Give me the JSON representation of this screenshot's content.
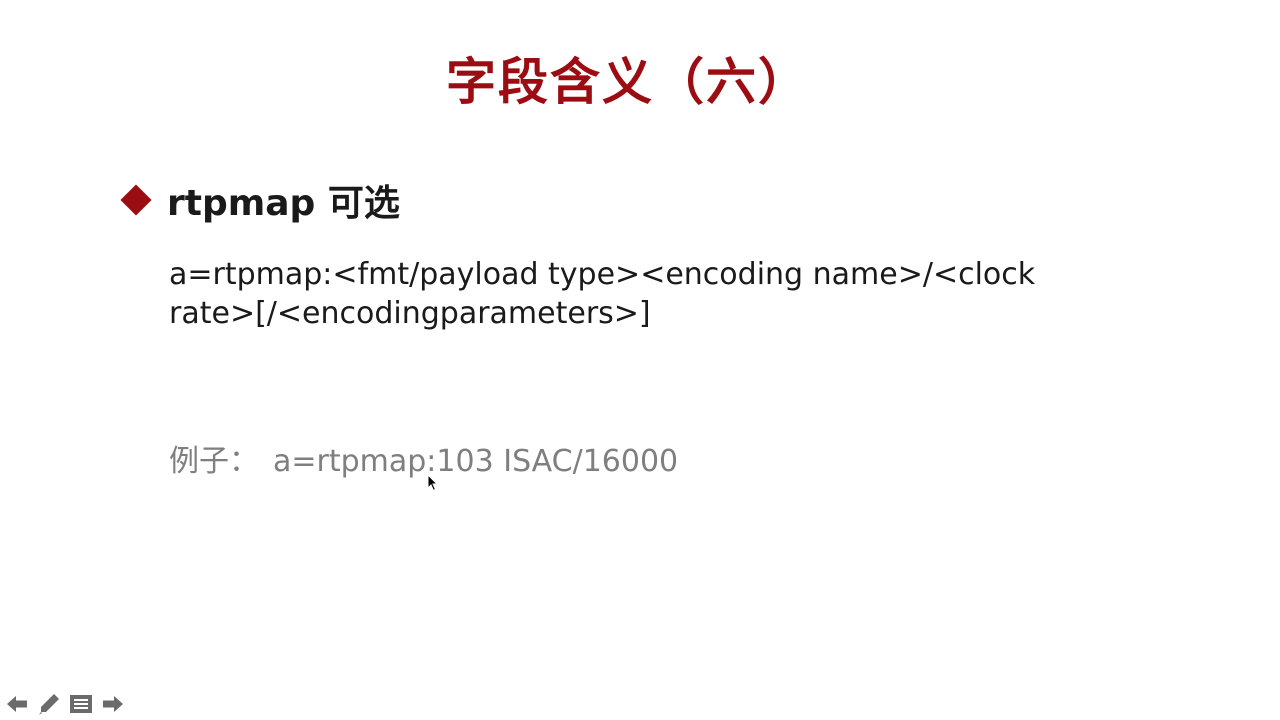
{
  "slide": {
    "title": "字段含义（六）",
    "bullet": {
      "text": "rtpmap 可选",
      "icon": "diamond-bullet-icon",
      "color": "#9b0d12"
    },
    "syntax_lines": [
      "a=rtpmap:<fmt/payload type><encoding name>/<clock",
      "rate>[/<encodingparameters>]"
    ],
    "example": {
      "label": "例子：",
      "value": "a=rtpmap:103 ISAC/16000"
    }
  },
  "toolbar": {
    "buttons": [
      {
        "name": "previous-slide-button",
        "icon": "arrow-left-icon"
      },
      {
        "name": "pen-tool-button",
        "icon": "pen-icon"
      },
      {
        "name": "slide-menu-button",
        "icon": "menu-icon"
      },
      {
        "name": "next-slide-button",
        "icon": "arrow-right-icon"
      }
    ]
  },
  "colors": {
    "accent": "#9b0d12",
    "text": "#1a1a1a",
    "muted": "#7f7f7f",
    "toolbar_icon": "#6b6b6b"
  }
}
